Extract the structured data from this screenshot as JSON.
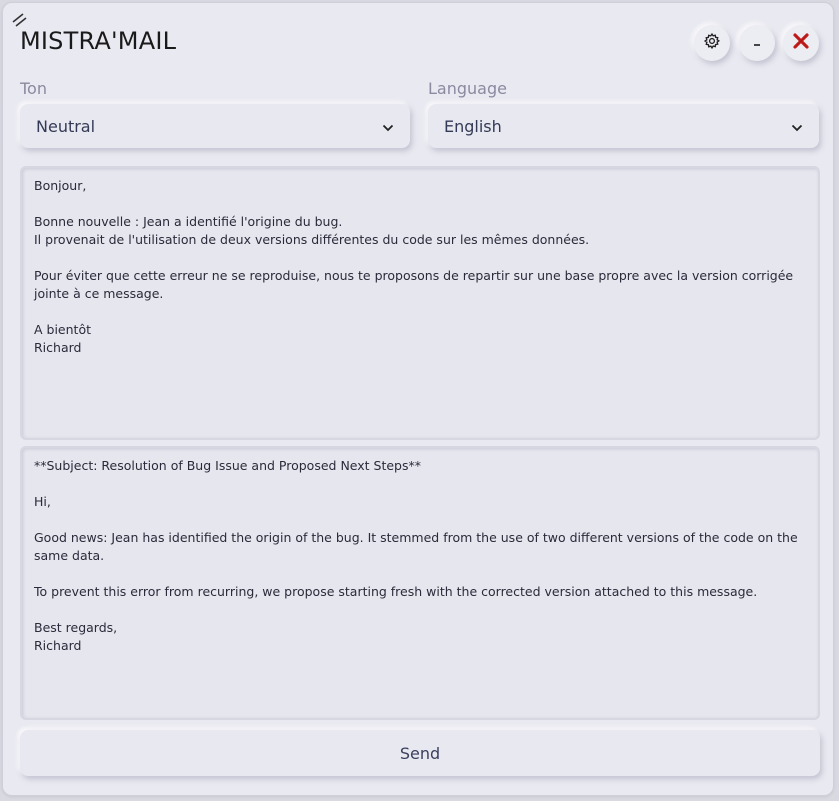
{
  "app": {
    "title": "MISTRA'MAIL"
  },
  "controls": {
    "tone": {
      "label": "Ton",
      "selected": "Neutral"
    },
    "language": {
      "label": "Language",
      "selected": "English"
    }
  },
  "window_buttons": {
    "settings_icon": "gear-icon",
    "minimize_label": "_",
    "close_icon": "close-icon",
    "close_color": "#c81e1e"
  },
  "source_text": "Bonjour,\n\nBonne nouvelle : Jean a identifié l'origine du bug.\nIl provenait de l'utilisation de deux versions différentes du code sur les mêmes données.\n\nPour éviter que cette erreur ne se reproduise, nous te proposons de repartir sur une base propre avec la version corrigée jointe à ce message.\n\nA bientôt\nRichard",
  "output_text": "**Subject: Resolution of Bug Issue and Proposed Next Steps**\n\nHi,\n\nGood news: Jean has identified the origin of the bug. It stemmed from the use of two different versions of the code on the same data.\n\nTo prevent this error from recurring, we propose starting fresh with the corrected version attached to this message.\n\nBest regards,\nRichard",
  "send_label": "Send"
}
